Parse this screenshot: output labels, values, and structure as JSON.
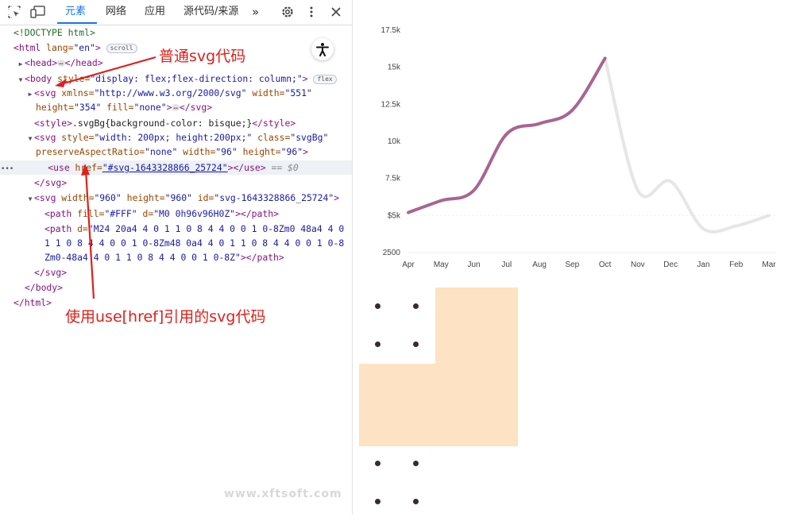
{
  "toolbar": {
    "tabs": [
      "元素",
      "网络",
      "应用",
      "源代码/来源"
    ],
    "more": "»"
  },
  "code": {
    "l1": "<!DOCTYPE html>",
    "l2_tag": "<html",
    "l2_attr": " lang=",
    "l2_val": "\"en\"",
    "l2_end": ">",
    "l2_pill": "scroll",
    "l3_open": "<head>",
    "l3_close": "</head>",
    "l3_dots": "…",
    "l4_tag": "<body",
    "l4_attr": " style=",
    "l4_val": "\"display: flex;flex-direction: column;\"",
    "l4_end": ">",
    "l4_pill": "flex",
    "l5_tag": "<svg",
    "l5_attr1": " xmlns=",
    "l5_val1": "\"http://www.w3.org/2000/svg\"",
    "l5_attr2": " width=",
    "l5_val2": "\"551\"",
    "l6_attr1": "height=",
    "l6_val1": "\"354\"",
    "l6_attr2": " fill=",
    "l6_val2": "\"none\"",
    "l6_end": ">",
    "l6_dots": "…",
    "l6_close": "</svg>",
    "l7_open": "<style>",
    "l7_text": ".svgBg{background-color: bisque;}",
    "l7_close": "</style>",
    "l8_tag": "<svg",
    "l8_attr1": " style=",
    "l8_val1": "\"width: 200px; height:200px;\"",
    "l8_attr2": " class=",
    "l8_val2": "\"svgBg\"",
    "l9_attr1": "preserveAspectRatio=",
    "l9_val1": "\"none\"",
    "l9_attr2": " width=",
    "l9_val2": "\"96\"",
    "l9_attr3": " height=",
    "l9_val3": "\"96\"",
    "l9_end": ">",
    "l10_tag": "<use",
    "l10_attr": " href=",
    "l10_val": "\"#svg-1643328866_25724\"",
    "l10_end": "></use>",
    "l10_eq": " == $0",
    "l10_dots": "•••",
    "l11": "</svg>",
    "l12_tag": "<svg",
    "l12_attr1": " width=",
    "l12_val1": "\"960\"",
    "l12_attr2": " height=",
    "l12_val2": "\"960\"",
    "l12_attr3": " id=",
    "l12_val3": "\"svg-1643328866_25724\"",
    "l12_end": ">",
    "l13_tag": "<path",
    "l13_attr1": " fill=",
    "l13_val1": "\"#FFF\"",
    "l13_attr2": " d=",
    "l13_val2": "\"M0 0h96v96H0Z\"",
    "l13_end": "></path>",
    "l14_tag": "<path",
    "l14_attr": " d=",
    "l14_val": "\"M24 20a4 4 0 1 1 0 8 4 4 0 0 1 0-8Zm0 48a4 4 0",
    "l15_val": "1 1 0 8 4 4 0 0 1 0-8Zm48 0a4 4 0 1 1 0 8 4 4 0 0 1 0-8",
    "l16_val": "Zm0-48a4 4 0 1 1 0 8 4 4 0 0 1 0-8Z\"",
    "l16_end": "></path>",
    "l17": "</svg>",
    "l18": "</body>",
    "l19": "</html>"
  },
  "annotations": {
    "top": "普通svg代码",
    "bottom": "使用use[href]引用的svg代码"
  },
  "watermark": "www.xftsoft.com",
  "colors": {
    "accent": "#1a73e8",
    "annotation": "#e0201b",
    "line_highlight": "#a86593",
    "line_muted": "#e6e6e6",
    "bisque": "#fde2c3"
  },
  "chart_data": {
    "type": "line",
    "categories": [
      "Apr",
      "May",
      "Jun",
      "Jul",
      "Aug",
      "Sep",
      "Oct",
      "Nov",
      "Dec",
      "Jan",
      "Feb",
      "Mar"
    ],
    "y_ticks": [
      "2500",
      "$5k",
      "7.5k",
      "10k",
      "12.5k",
      "15k",
      "17.5k"
    ],
    "ylim": [
      2500,
      17500
    ],
    "series": [
      {
        "highlighted_x": [
          "Apr",
          "Oct"
        ],
        "values": [
          5200,
          6000,
          6700,
          10500,
          11200,
          12100,
          15600,
          6700,
          7300,
          4100,
          4300,
          5000
        ]
      }
    ],
    "grid": false
  }
}
